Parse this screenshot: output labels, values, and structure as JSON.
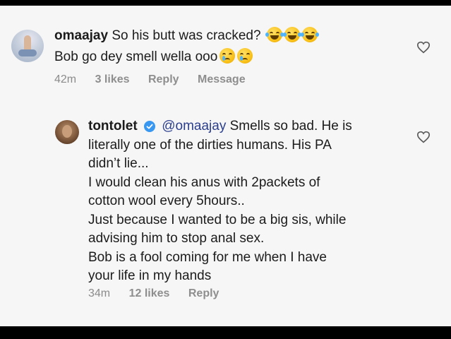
{
  "comments": [
    {
      "username": "omaajay",
      "lines": [
        "So his butt was cracked?",
        "Bob go dey smell wella ooo"
      ],
      "emoji_line1": [
        "laughing-with-tears",
        "laughing-with-tears",
        "laughing-with-tears"
      ],
      "emoji_line2": [
        "crying-face",
        "crying-face"
      ],
      "time": "42m",
      "likes": "3 likes",
      "reply_label": "Reply",
      "message_label": "Message"
    },
    {
      "username": "tontolet",
      "verified": true,
      "mention": "@omaajay",
      "lines": [
        "Smells so bad. He is",
        "literally one of the dirties humans. His PA",
        "didn’t lie...",
        "I would clean his anus with 2packets of",
        "cotton wool every 5hours..",
        "Just because I wanted to be a big sis, while",
        "advising him to stop anal sex.",
        "Bob is a fool coming for me when I have",
        "your life in my hands"
      ],
      "time": "34m",
      "likes": "12 likes",
      "reply_label": "Reply"
    }
  ],
  "colors": {
    "background": "#f6f6f6",
    "text": "#1b1b1b",
    "mention": "#2b3f8e",
    "meta": "#8b8b8b",
    "verified": "#3897f0"
  }
}
